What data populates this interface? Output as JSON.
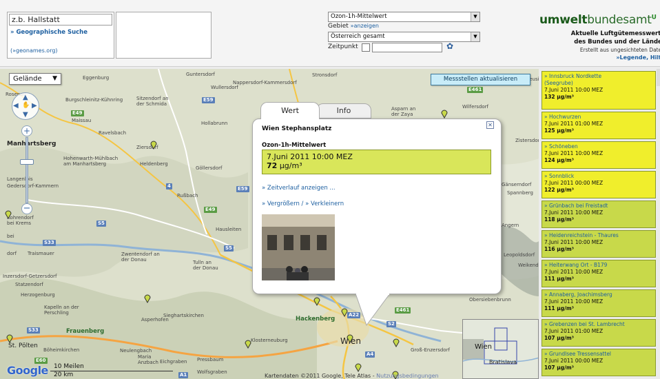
{
  "header": {
    "search_value": "z.b. Hallstatt",
    "geo_search_link": "» Geographische Suche",
    "geonames_link": "(»geonames.org)",
    "parameter_select": "Ozon-1h-Mittelwert",
    "gebiet_label": "Gebiet",
    "gebiet_link": "»anzeigen",
    "region_select": "Österreich gesamt",
    "zeitpunkt_label": "Zeitpunkt",
    "logo_bold": "umwelt",
    "logo_regular": "bundesamt",
    "logo_mark": "U",
    "tagline1": "Aktuelle Luftgütemesswerte",
    "tagline2": "des Bundes und der Länder",
    "tagline3": "Erstellt aus ungesichteten Daten",
    "legend_link": "»Legende, Hilfe"
  },
  "map": {
    "terrain_button": "Gelände",
    "stations_button": "Messstellen aktualisieren",
    "scale_miles": "10 Meilen",
    "scale_km": "20 km",
    "google_logo": "Google",
    "copyright": "Kartendaten ©2011 Google, Tele Atlas -",
    "terms_link": "Nutzungsbedingungen",
    "overview_wien": "Wien",
    "overview_bratislava": "Bratislava",
    "places": {
      "eggenburg": "Eggenburg",
      "guntersdorf": "Guntersdorf",
      "wullersdorf": "Wullersdorf",
      "nappersdorf": "Nappersdorf-Kammersdorf",
      "stronsdorf": "Stronsdorf",
      "rosenau": "Rosenau",
      "burgschleinitz": "Burgschleinitz-Kühnring",
      "sitzendorf": "Sitzendorf an der Schmida",
      "hollabrunn": "Hollabrunn",
      "asparn": "Asparn an der Zaya",
      "wilfersdorf": "Wilfersdorf",
      "maissau": "Maissau",
      "ravelsbach": "Ravelsbach",
      "ziersdorf": "Ziersdorf",
      "manhartsberg": "Manhartsberg",
      "hohenwarth": "Hohenwarth-Mühlbach am Manhartsberg",
      "heldenberg": "Heldenberg",
      "gollersdorf": "Göllersdorf",
      "gedersdorf": "Gedersdorf",
      "lengenlois": "Langenlois",
      "kammern": "Gedersdorf-Kammern",
      "russbach": "Rußbach",
      "rohrendorf": "Rohrendorf bei Krems",
      "hausleiten": "Hausleiten",
      "traismauer": "Traismauer",
      "zwentendorf": "Zwentendorf an der Donau",
      "tulln": "Tulln an der Donau",
      "getzersdorf": "Inzersdorf-Getzersdorf",
      "statzendorf": "Statzendorf",
      "herzogenburg": "Herzogenburg",
      "kapelln": "Kapelln an der Perschling",
      "asperhofen": "Asperhofen",
      "sieghartskirchen": "Sieghartskirchen",
      "frauenberg": "Frauenberg",
      "hackenberg": "Hackenberg",
      "polten": "St. Pölten",
      "boheimkirchen": "Böheimkirchen",
      "neulengbach": "Neulengbach",
      "maria_anzbach": "Maria Anzbach",
      "eichgraben": "Eichgraben",
      "pressbaum": "Pressbaum",
      "wolfsgraben": "Wolfsgraben",
      "klosterneuburg": "Klosterneuburg",
      "wien": "Wien",
      "gross_enzersdorf": "Groß-Enzersdorf",
      "obersiebenbrunn": "Obersiebenbrunn",
      "gotzendorf": "Gänserndorf",
      "spannberg": "Spannberg",
      "zistersdorf": "Zistersdorf",
      "gaenserndorf": "Gänserndorf",
      "neusiedl": "Neusiedl",
      "eyersdorf": "Leopoldsdorf",
      "weiken": "Weikendorf",
      "angendorf": "Angern",
      "bei": "bei",
      "dorf": "dorf"
    },
    "roads": {
      "e49a": "E49",
      "e59a": "E59",
      "e49b": "E49",
      "e59b": "E59",
      "s5a": "S5",
      "s5b": "S5",
      "s33": "S33",
      "s33b": "S33",
      "e461a": "E461",
      "e461b": "E461",
      "a22": "A22",
      "s2": "S2",
      "a4": "A4",
      "e60": "E60",
      "a1": "A1",
      "n4": "4"
    }
  },
  "info_window": {
    "tab_wert": "Wert",
    "tab_info": "Info",
    "station_title": "Wien Stephansplatz",
    "parameter_title": "Ozon-1h-Mittelwert",
    "value_time": "7.Juni 2011 10:00 MEZ",
    "value_number": "72",
    "value_unit": "µg/m³",
    "trend_link": "» Zeitverlauf anzeigen ...",
    "zoom_in_link": "» Vergrößern",
    "zoom_separator": " / ",
    "zoom_out_link": "» Verkleinern"
  },
  "stations": [
    {
      "name": "» Innsbruck Nordkette",
      "name2": "(Seegrube)",
      "time": "7.Juni 2011 10:00 MEZ",
      "value": "132 µg/m³",
      "color": "#f0ee2c"
    },
    {
      "name": "» Hochwurzen",
      "name2": "",
      "time": "7.Juni 2011 01:00 MEZ",
      "value": "125 µg/m³",
      "color": "#f0ee2c"
    },
    {
      "name": "» Schöneben",
      "name2": "",
      "time": "7.Juni 2011 10:00 MEZ",
      "value": "124 µg/m³",
      "color": "#f0ee2c"
    },
    {
      "name": "» Sonnblick",
      "name2": "",
      "time": "7.Juni 2011 00:00 MEZ",
      "value": "122 µg/m³",
      "color": "#f0ee2c"
    },
    {
      "name": "» Grünbach bei Freistadt",
      "name2": "",
      "time": "7.Juni 2011 10:00 MEZ",
      "value": "118 µg/m³",
      "color": "#c8d94a"
    },
    {
      "name": "» Heidenreichstein - Thaures",
      "name2": "",
      "time": "7.Juni 2011 10:00 MEZ",
      "value": "116 µg/m³",
      "color": "#c8d94a"
    },
    {
      "name": "» Heiterwang Ort - B179",
      "name2": "",
      "time": "7.Juni 2011 10:00 MEZ",
      "value": "111 µg/m³",
      "color": "#c8d94a"
    },
    {
      "name": "» Annaberg, Joachimsberg",
      "name2": "",
      "time": "7.Juni 2011 10:00 MEZ",
      "value": "111 µg/m³",
      "color": "#c8d94a"
    },
    {
      "name": "» Grebenzen bei St. Lambrecht",
      "name2": "",
      "time": "7.Juni 2011 01:00 MEZ",
      "value": "107 µg/m³",
      "color": "#c8d94a"
    },
    {
      "name": "» Grundlsee Tressensattel",
      "name2": "",
      "time": "7.Juni 2011 00:00 MEZ",
      "value": "107 µg/m³",
      "color": "#c8d94a"
    }
  ],
  "icons": {
    "refresh": "refresh-icon",
    "select_arrow": "chevron-down-icon",
    "pan": "pan-control-icon",
    "close": "close-icon",
    "marker": "map-marker-icon"
  }
}
